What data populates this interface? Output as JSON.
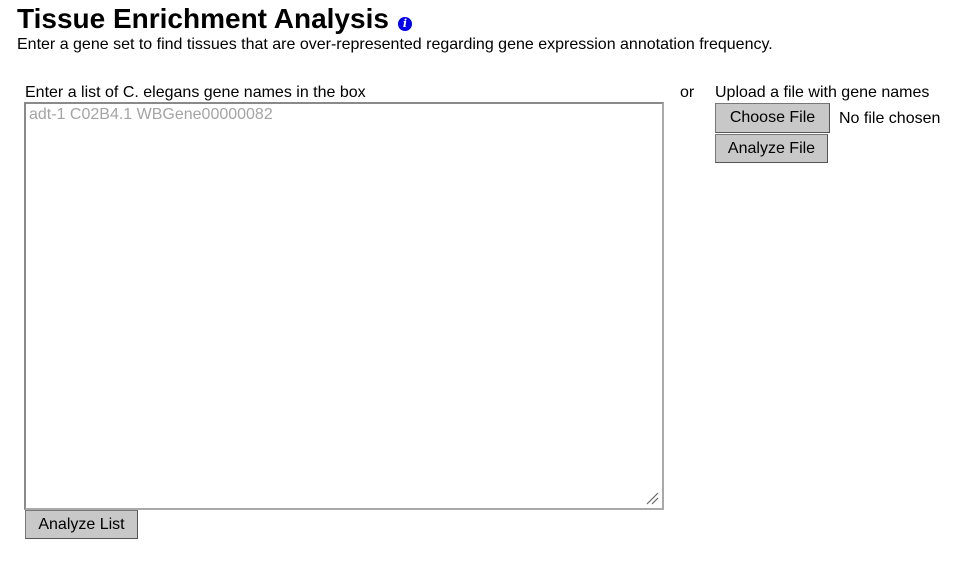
{
  "header": {
    "title": "Tissue Enrichment Analysis",
    "info_icon": "info-icon",
    "subtitle": "Enter a gene set to find tissues that are over-represented regarding gene expression annotation frequency."
  },
  "list_section": {
    "label": "Enter a list of C. elegans gene names in the box",
    "placeholder": "adt-1 C02B4.1 WBGene00000082",
    "value": "",
    "analyze_button": "Analyze List"
  },
  "separator": {
    "text": "or"
  },
  "file_section": {
    "label": "Upload a file with gene names",
    "choose_button": "Choose File",
    "file_status": "No file chosen",
    "analyze_button": "Analyze File"
  },
  "colors": {
    "info_icon": "#0000ee",
    "placeholder": "#a4a4a4",
    "button_bg": "#c8c8c8"
  }
}
